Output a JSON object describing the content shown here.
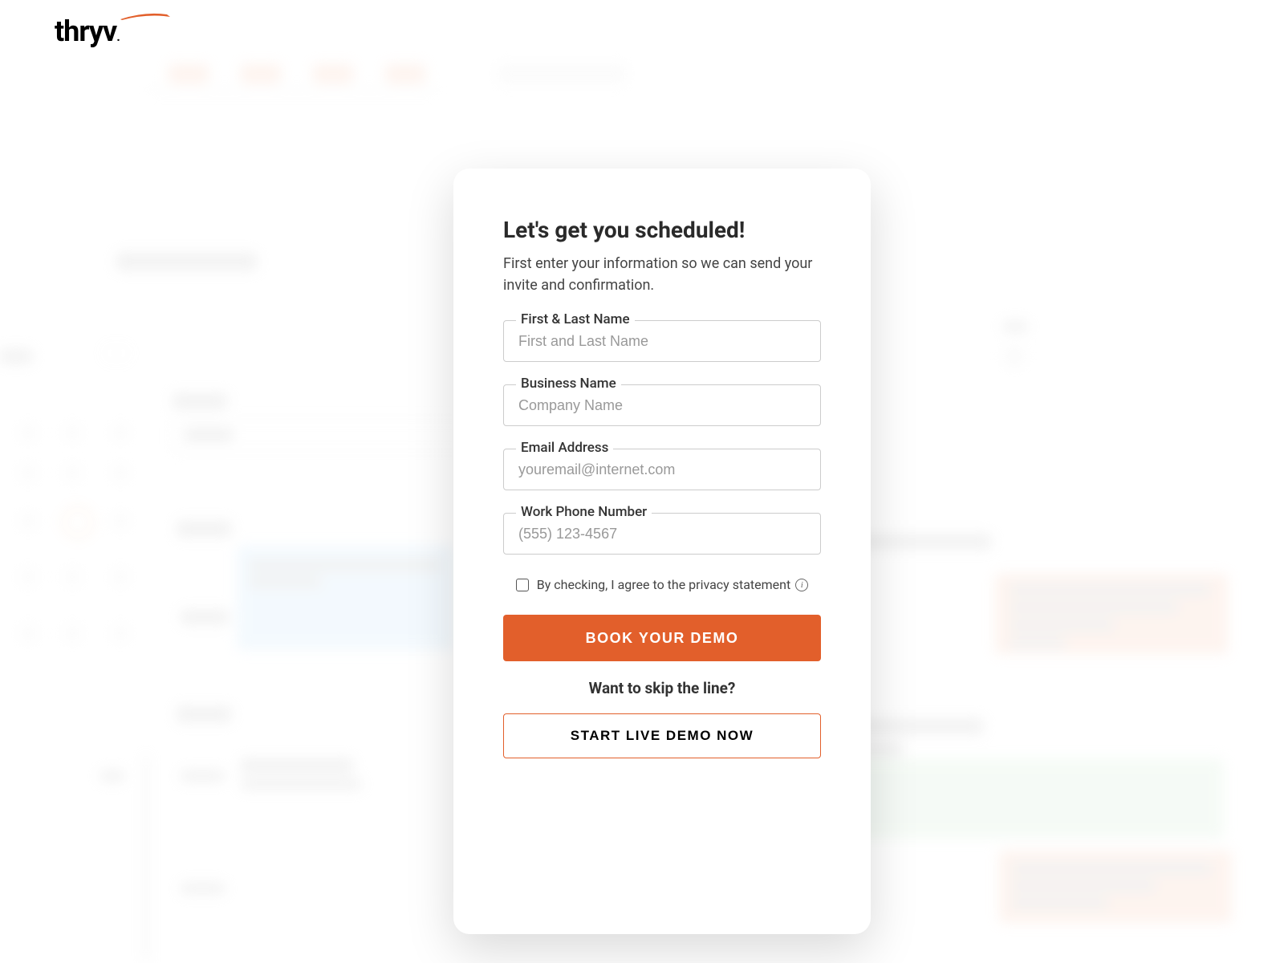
{
  "logo": {
    "text": "thryv",
    "accent_color": "#e25f2b"
  },
  "modal": {
    "title": "Let's get you scheduled!",
    "subtitle": "First enter your information so we can send your invite and confirmation.",
    "fields": {
      "name": {
        "label": "First & Last Name",
        "placeholder": "First and Last Name"
      },
      "business": {
        "label": "Business Name",
        "placeholder": "Company Name"
      },
      "email": {
        "label": "Email Address",
        "placeholder": "youremail@internet.com"
      },
      "phone": {
        "label": "Work Phone Number",
        "placeholder": "(555) 123-4567"
      }
    },
    "checkbox_label": "By checking, I agree to the privacy statement",
    "primary_button": "BOOK YOUR DEMO",
    "skip_text": "Want to skip the line?",
    "secondary_button": "START LIVE DEMO NOW"
  }
}
